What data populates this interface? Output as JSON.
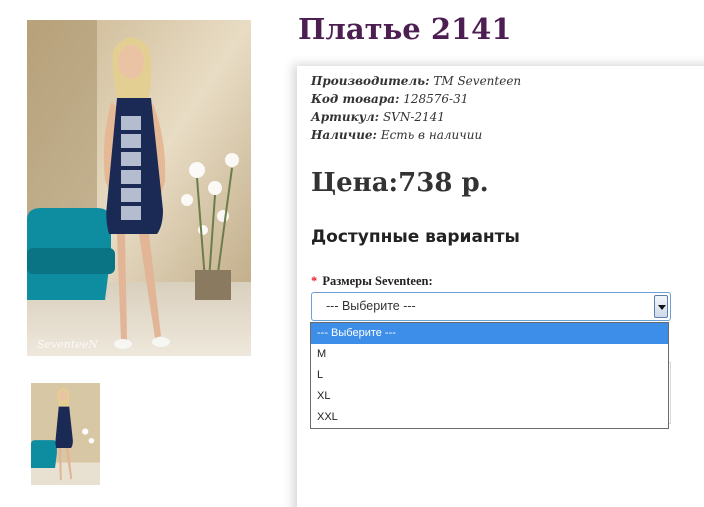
{
  "product": {
    "title": "Платье 2141",
    "details": [
      {
        "label": "Производитель:",
        "value": "TM Seventeen"
      },
      {
        "label": "Код товара:",
        "value": "128576-31"
      },
      {
        "label": "Артикул:",
        "value": "SVN-2141"
      },
      {
        "label": "Наличие:",
        "value": "Есть в наличии"
      }
    ],
    "price": "Цена:738 р."
  },
  "variants": {
    "heading": "Доступные варианты",
    "required_mark": "*",
    "size_label": "Размеры Seventeen:",
    "select_value": "--- Выберите ---",
    "options": [
      "--- Выберите ---",
      "M",
      "L",
      "XL",
      "XXL"
    ]
  },
  "images": {
    "main_watermark": "SeventeeN"
  },
  "colors": {
    "title": "#4d1e52",
    "highlight": "#3d8ee8",
    "required": "#e2222b",
    "dress": "#1b2a55"
  }
}
